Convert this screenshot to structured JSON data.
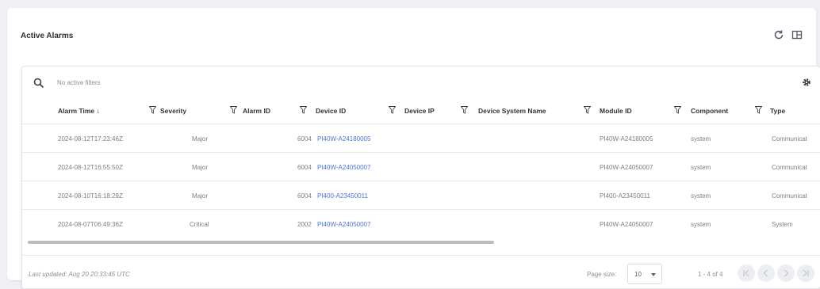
{
  "panel": {
    "title": "Active Alarms"
  },
  "filter": {
    "text": "No active filters"
  },
  "columns": {
    "alarm_time": "Alarm Time ↓",
    "severity": "Severity",
    "alarm_id": "Alarm ID",
    "device_id": "Device ID",
    "device_ip": "Device IP",
    "device_system_name": "Device System Name",
    "module_id": "Module ID",
    "component": "Component",
    "type": "Type"
  },
  "rows": [
    {
      "alarm_time": "2024-08-12T17:23:46Z",
      "severity": "Major",
      "alarm_id": "6004",
      "device_id": "PI40W-A24180005",
      "device_ip": "",
      "device_system_name": "",
      "module_id": "PI40W-A24180005",
      "component": "system",
      "type": "Communicat"
    },
    {
      "alarm_time": "2024-08-12T16:55:50Z",
      "severity": "Major",
      "alarm_id": "6004",
      "device_id": "PI40W-A24050007",
      "device_ip": "",
      "device_system_name": "",
      "module_id": "PI40W-A24050007",
      "component": "system",
      "type": "Communicat"
    },
    {
      "alarm_time": "2024-08-10T16:18:29Z",
      "severity": "Major",
      "alarm_id": "6004",
      "device_id": "PI400-A23450011",
      "device_ip": "",
      "device_system_name": "",
      "module_id": "PI400-A23450011",
      "component": "system",
      "type": "Communicat"
    },
    {
      "alarm_time": "2024-08-07T06:49:36Z",
      "severity": "Critical",
      "alarm_id": "2002",
      "device_id": "PI40W-A24050007",
      "device_ip": "",
      "device_system_name": "",
      "module_id": "PI40W-A24050007",
      "component": "system",
      "type": "System"
    }
  ],
  "footer": {
    "last_updated": "Last updated: Aug 20 20:33:45 UTC",
    "page_size_label": "Page size:",
    "page_size_value": "10",
    "range": "1 - 4 of 4"
  },
  "icons": {
    "refresh": "refresh-icon",
    "layout": "layout-icon",
    "search": "search-icon",
    "settings": "gear-icon",
    "filter": "funnel-icon"
  }
}
